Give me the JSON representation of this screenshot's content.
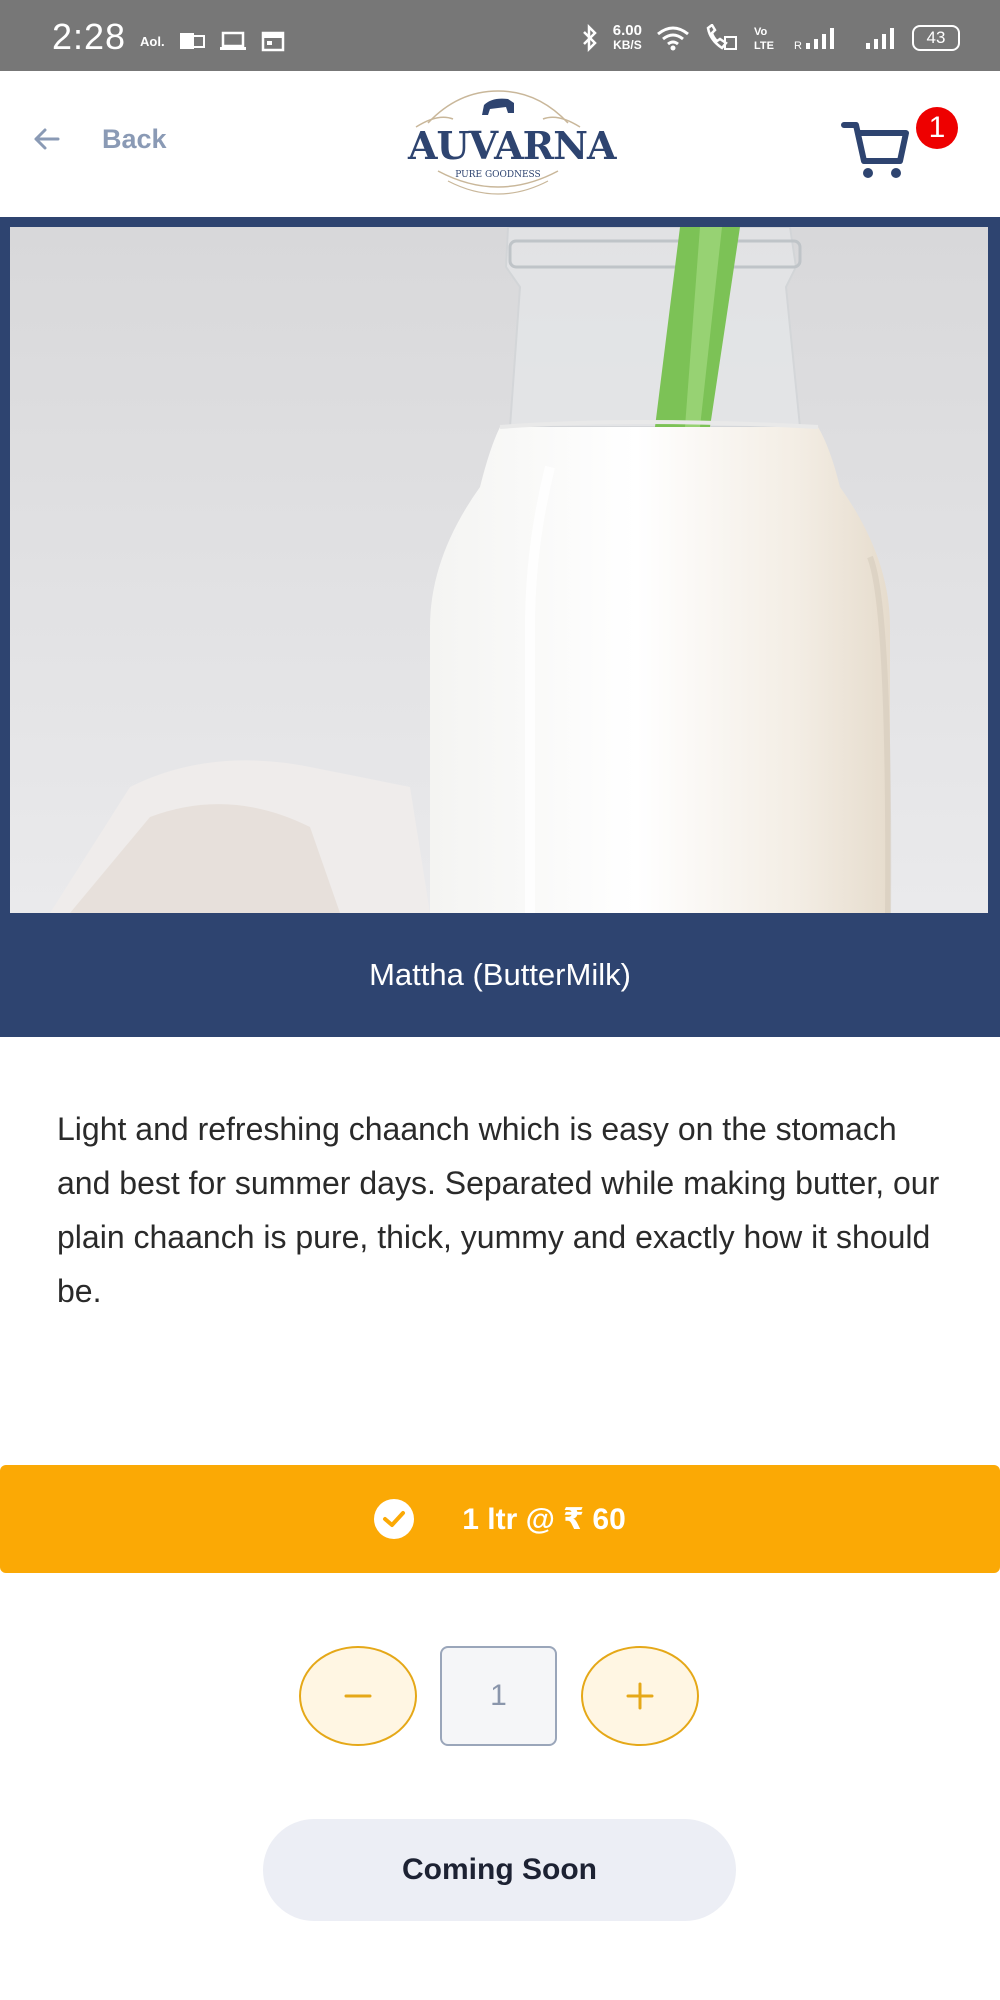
{
  "status_bar": {
    "time": "2:28",
    "left_icons": [
      "aol-icon",
      "outlook-icon",
      "laptop-icon",
      "calendar-icon"
    ],
    "aol_label": "Aol.",
    "speed_value": "6.00",
    "speed_unit": "KB/S",
    "network_label": "Vo LTE",
    "battery": "43"
  },
  "header": {
    "back_label": "Back",
    "logo_text": "AUVARNA",
    "logo_tagline": "PURE GOODNESS",
    "cart_count": "1"
  },
  "product": {
    "title": "Mattha (ButterMilk)",
    "description": "Light and refreshing chaanch which is easy on the stomach and best for summer days. Separated while making butter, our plain chaanch is pure, thick, yummy and exactly how it should be."
  },
  "variant": {
    "label": "1 ltr @ ₹ 60",
    "selected": true
  },
  "quantity": {
    "value": "1"
  },
  "action": {
    "label": "Coming Soon"
  },
  "colors": {
    "brand_navy": "#2e4470",
    "accent_orange": "#fba905",
    "badge_red": "#ee0000"
  }
}
